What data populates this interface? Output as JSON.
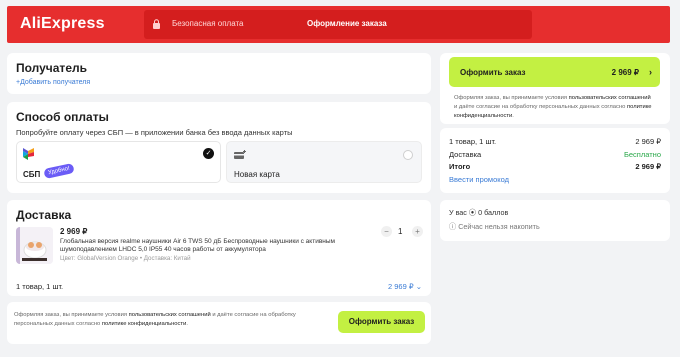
{
  "header": {
    "logo": "AliExpress",
    "secure_label": "Безопасная оплата",
    "title": "Оформление заказа",
    "brand_color": "#e62e2e"
  },
  "recipient": {
    "title": "Получатель",
    "add_link": "+Добавить получателя"
  },
  "payment": {
    "title": "Способ оплаты",
    "hint": "Попробуйте оплату через СБП — в приложении банка без ввода данных карты",
    "options": [
      {
        "label": "СБП",
        "badge": "Удобно!",
        "selected": true,
        "icon": "sbp-logo-icon"
      },
      {
        "label": "Новая карта",
        "selected": false,
        "icon": "card-add-icon"
      }
    ]
  },
  "delivery": {
    "title": "Доставка",
    "item": {
      "price": "2 969 ₽",
      "title": "Глобальная версия realme наушники Air 6 TWS 50 дБ Беспроводные наушники с активным шумоподавлением LHDC 5,0 IP55 40 часов работы от аккумулятора",
      "meta": "Цвет: GlobalVersion Orange • Доставка: Китай",
      "quantity": "1"
    },
    "summary_label": "1 товар, 1 шт.",
    "summary_price": "2 969 ₽"
  },
  "bottom": {
    "consent_pre": "Оформляя заказ, вы принимаете условия ",
    "consent_link1": "пользовательских соглашений",
    "consent_mid": " и даёте согласие на обработку персональных данных согласно ",
    "consent_link2": "политике конфиденциальности",
    "consent_end": ".",
    "order_button": "Оформить заказ"
  },
  "sidebar": {
    "order_button": "Оформить заказ",
    "order_total": "2 969 ₽",
    "consent_pre": "Оформляя заказ, вы принимаете условия ",
    "consent_link1": "пользовательских соглашений",
    "consent_mid": " и даёте согласие на обработку персональных данных согласно ",
    "consent_link2": "политике конфиденциальности",
    "consent_end": ".",
    "rows": [
      {
        "label": "1 товар, 1 шт.",
        "value": "2 969 ₽"
      },
      {
        "label": "Доставка",
        "value": "Бесплатно"
      },
      {
        "label": "Итого",
        "value": "2 969 ₽"
      }
    ],
    "promo_link": "Ввести промокод",
    "points": "У вас ⦿ 0 баллов",
    "cant_accumulate": "Сейчас нельзя накопить",
    "accent_green": "#c3f042"
  }
}
